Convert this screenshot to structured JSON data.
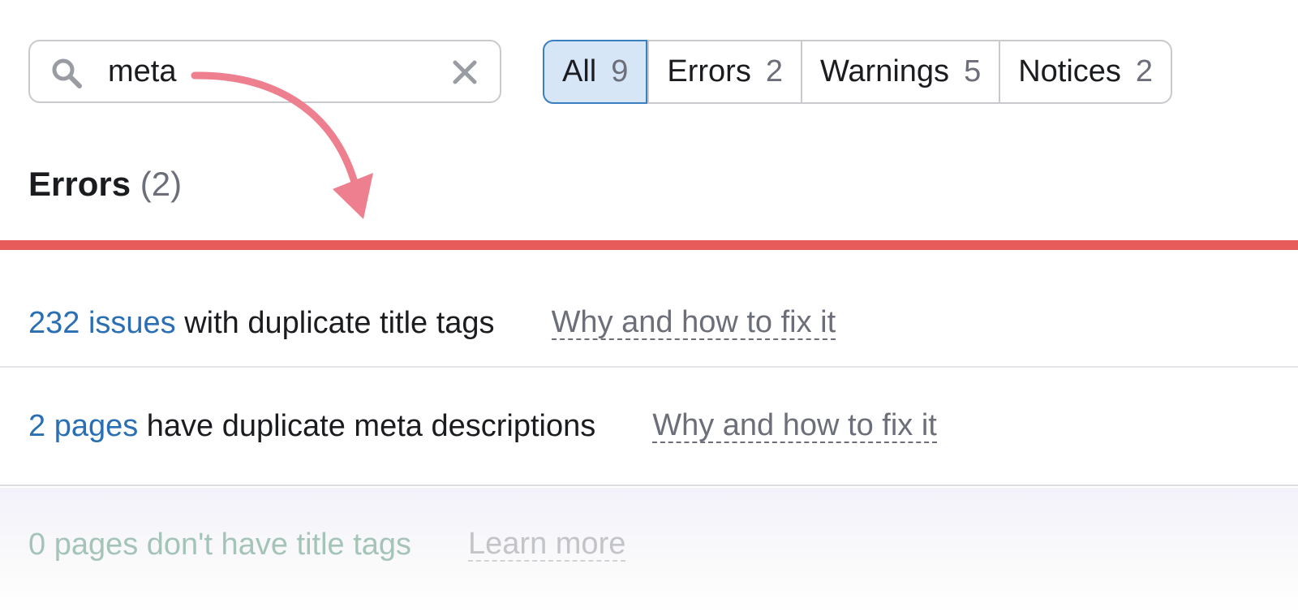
{
  "search": {
    "value": "meta",
    "icon": "search-icon",
    "clear_icon": "close-icon"
  },
  "tabs": [
    {
      "label": "All",
      "count": "9",
      "active": true
    },
    {
      "label": "Errors",
      "count": "2"
    },
    {
      "label": "Warnings",
      "count": "5"
    },
    {
      "label": "Notices",
      "count": "2"
    }
  ],
  "section": {
    "title": "Errors",
    "count": "(2)",
    "accent": "#e85b5b"
  },
  "issues": [
    {
      "link": "232 issues",
      "text": " with duplicate title tags",
      "help": "Why and how to fix it"
    },
    {
      "link": "2 pages",
      "text": " have duplicate meta descriptions",
      "help": "Why and how to fix it"
    },
    {
      "text": "0 pages don't have title tags",
      "help": "Learn more"
    }
  ],
  "annotation": {
    "arrow_color": "#ee7f8e"
  }
}
